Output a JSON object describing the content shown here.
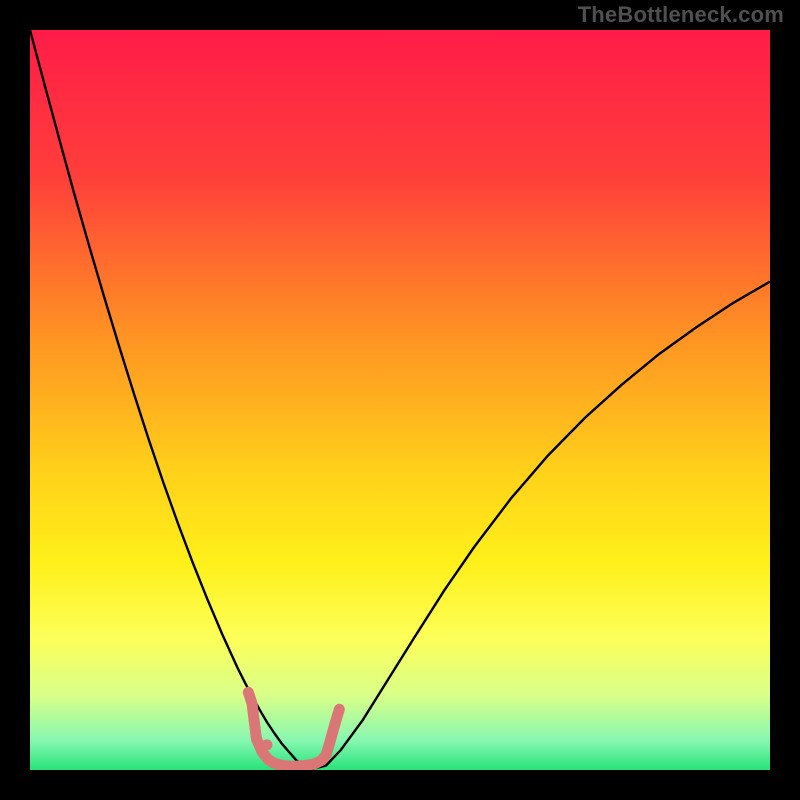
{
  "watermark": "TheBottleneck.com",
  "chart_data": {
    "type": "line",
    "title": "",
    "xlabel": "",
    "ylabel": "",
    "xlim": [
      0,
      100
    ],
    "ylim": [
      0,
      100
    ],
    "gradient_stops": [
      {
        "offset": 0.0,
        "color": "#ff1c48"
      },
      {
        "offset": 0.2,
        "color": "#ff3f3a"
      },
      {
        "offset": 0.4,
        "color": "#ff8e24"
      },
      {
        "offset": 0.6,
        "color": "#ffd21a"
      },
      {
        "offset": 0.72,
        "color": "#fff01a"
      },
      {
        "offset": 0.82,
        "color": "#fdff58"
      },
      {
        "offset": 0.9,
        "color": "#d9ff8a"
      },
      {
        "offset": 0.96,
        "color": "#87f7b0"
      },
      {
        "offset": 1.0,
        "color": "#27e37a"
      }
    ],
    "series": [
      {
        "name": "curve",
        "color": "#000000",
        "width": 2.4,
        "x": [
          0,
          2,
          4,
          6,
          8,
          10,
          12,
          14,
          16,
          18,
          20,
          22,
          24,
          26,
          27,
          28,
          29,
          30,
          31,
          32,
          33,
          34,
          36,
          38,
          40,
          42,
          45,
          48,
          52,
          56,
          60,
          65,
          70,
          75,
          80,
          85,
          90,
          95,
          100
        ],
        "y": [
          100,
          92.5,
          85.1,
          77.8,
          70.8,
          64.0,
          57.4,
          51.0,
          44.8,
          38.9,
          33.3,
          28.0,
          23.0,
          18.3,
          16.1,
          13.9,
          11.9,
          10.0,
          8.2,
          6.5,
          5.0,
          3.6,
          1.3,
          0.1,
          0.6,
          2.7,
          6.8,
          11.6,
          18.0,
          24.3,
          30.1,
          36.7,
          42.5,
          47.6,
          52.1,
          56.2,
          59.8,
          63.1,
          66.0
        ]
      },
      {
        "name": "highlight",
        "color": "#db7676",
        "width": 11,
        "linecap": "round",
        "x": [
          29.5,
          30.0,
          30.6,
          31.4,
          32.2,
          33.0,
          34.2,
          35.6,
          37.0,
          38.4,
          39.4,
          40.0,
          40.3,
          40.7,
          41.2,
          41.8
        ],
        "y": [
          10.5,
          9.0,
          4.2,
          2.4,
          1.4,
          0.9,
          0.6,
          0.5,
          0.6,
          0.8,
          1.3,
          2.0,
          3.0,
          4.4,
          6.2,
          8.2
        ]
      },
      {
        "name": "highlight-dot",
        "color": "#db7676",
        "width": 11,
        "linecap": "round",
        "x": [
          32.0,
          32.02
        ],
        "y": [
          3.4,
          3.4
        ]
      }
    ]
  }
}
